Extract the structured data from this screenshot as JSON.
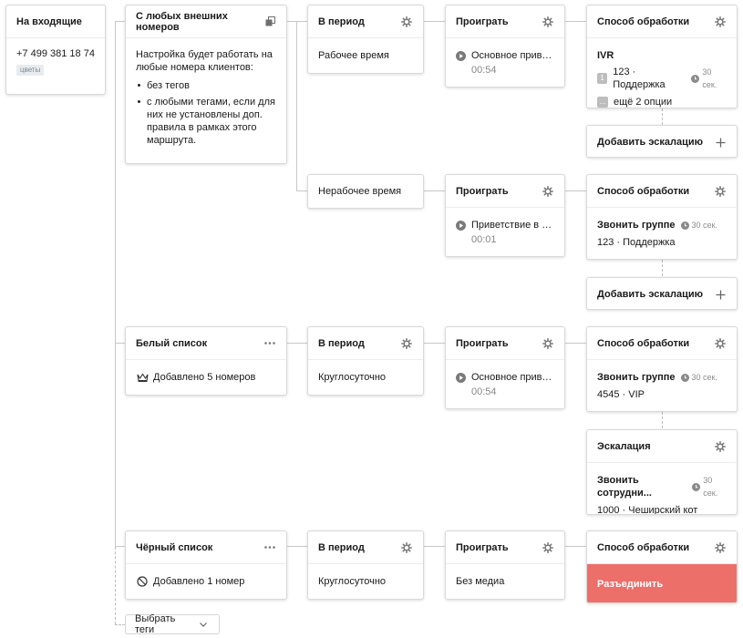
{
  "incoming": {
    "title": "На входящие",
    "phone": "+7 499 381 18 74",
    "tag": "цветы"
  },
  "rules": {
    "any": {
      "title": "С любых внешних номеров",
      "intro": "Настройка будет работать на любые номера клиентов:",
      "bullets": [
        "без тегов",
        "с любыми тегами, если для них не установлены доп. правила в рамках этого маршрута."
      ]
    },
    "white": {
      "title": "Белый список",
      "info": "Добавлено 5 номеров"
    },
    "black": {
      "title": "Чёрный список",
      "info": "Добавлено 1 номер"
    }
  },
  "periods": {
    "work": {
      "title": "В период",
      "value": "Рабочее время"
    },
    "nonwork": {
      "value": "Нерабочее время"
    },
    "white": {
      "title": "В период",
      "value": "Круглосуточно"
    },
    "black": {
      "title": "В период",
      "value": "Круглосуточно"
    }
  },
  "plays": {
    "r1": {
      "title": "Проиграть",
      "name": "Основное привет...",
      "time": "00:54"
    },
    "r2": {
      "title": "Проиграть",
      "name": "Приветствие в не...",
      "time": "00:01"
    },
    "r3": {
      "title": "Проиграть",
      "name": "Основное привет...",
      "time": "00:54"
    },
    "r4": {
      "title": "Проиграть",
      "name": "Без медиа"
    }
  },
  "handling": {
    "h1": {
      "title": "Способ обработки",
      "type": "IVR",
      "opt_num": "1",
      "opt_label": "123 · Поддержка",
      "opt_time": "30 сек.",
      "more_icon": "...",
      "more_label": "ещё 2 опции"
    },
    "h2": {
      "title": "Способ обработки",
      "type": "Звонить группе",
      "time": "30 сек.",
      "target": "123 · Поддержка"
    },
    "h3": {
      "title": "Способ обработки",
      "type": "Звонить группе",
      "time": "30 сек.",
      "target": "4545 · VIP"
    },
    "h4": {
      "title": "Способ обработки",
      "action": "Разъединить"
    }
  },
  "escalation": {
    "add1": "Добавить эскалацию",
    "add2": "Добавить эскалацию",
    "card": {
      "title": "Эскалация",
      "type": "Звонить сотрудни...",
      "time": "30 сек.",
      "target": "1000 · Чеширский кот"
    }
  },
  "select_tags": "Выбрать теги",
  "colors": {
    "danger": "#ec6f6a",
    "border": "#d9d9d9",
    "tag_bg": "#e8ecef"
  }
}
